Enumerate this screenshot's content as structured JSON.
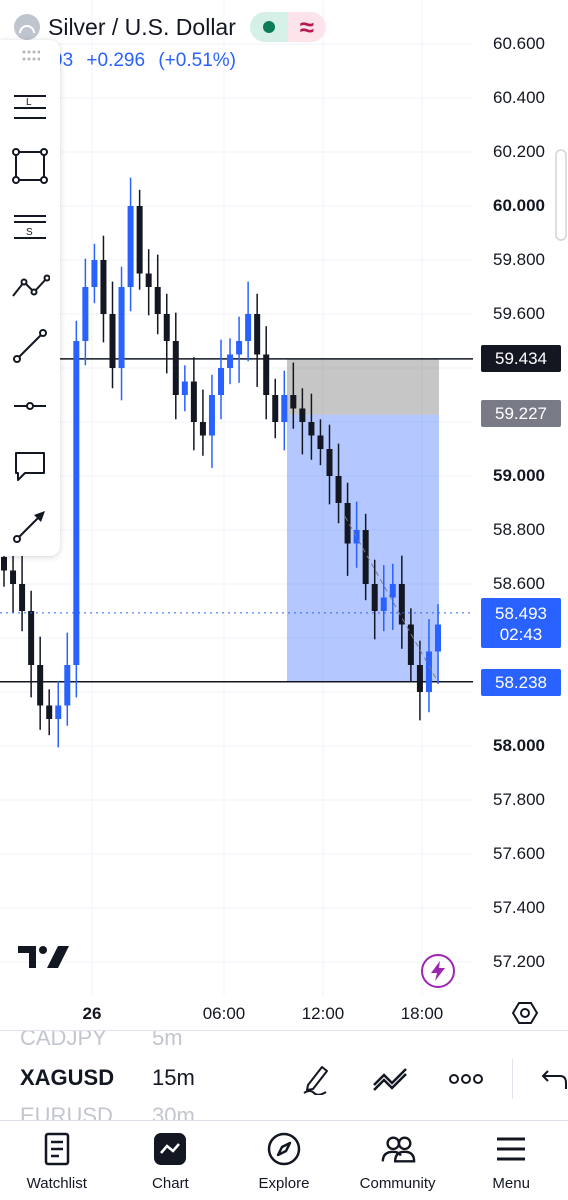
{
  "header": {
    "symbol_name": "Silver / U.S. Dollar",
    "last_price_partial": "93",
    "change": "+0.296",
    "change_pct": "(+0.51%)",
    "market_status_icon": "market-open-dot",
    "delay_icon": "approximate-icon"
  },
  "drawing_toolbar": {
    "tools": [
      "horizontal-lines-L-icon",
      "rectangle-icon",
      "horizontal-lines-S-icon",
      "polyline-icon",
      "trendline-icon",
      "horizontal-ray-icon",
      "callout-icon",
      "arrow-line-icon"
    ]
  },
  "price_axis": {
    "labels": [
      {
        "text": "60.600",
        "bold": false
      },
      {
        "text": "60.400",
        "bold": false
      },
      {
        "text": "60.200",
        "bold": false
      },
      {
        "text": "60.000",
        "bold": true
      },
      {
        "text": "59.800",
        "bold": false
      },
      {
        "text": "59.600",
        "bold": false
      },
      {
        "text": "59.000",
        "bold": true
      },
      {
        "text": "58.800",
        "bold": false
      },
      {
        "text": "58.600",
        "bold": false
      },
      {
        "text": "58.000",
        "bold": true
      },
      {
        "text": "57.800",
        "bold": false
      },
      {
        "text": "57.600",
        "bold": false
      },
      {
        "text": "57.400",
        "bold": false
      },
      {
        "text": "57.200",
        "bold": false
      }
    ]
  },
  "price_tags": {
    "upper_line": "59.434",
    "entry": "59.227",
    "current_price": "58.493",
    "countdown": "02:43",
    "lower_line": "58.238"
  },
  "time_axis": {
    "labels": [
      {
        "text": "26",
        "bold": true
      },
      {
        "text": "06:00",
        "bold": false
      },
      {
        "text": "12:00",
        "bold": false
      },
      {
        "text": "18:00",
        "bold": false
      }
    ]
  },
  "symbol_strip": {
    "rows": [
      {
        "symbol": "CADJPY",
        "interval": "5m",
        "state": "faded"
      },
      {
        "symbol": "XAGUSD",
        "interval": "15m",
        "state": "current"
      },
      {
        "symbol": "EURUSD",
        "interval": "30m",
        "state": "faded"
      }
    ],
    "tools": [
      "pencil-icon",
      "multi-line-icon",
      "more-dots-icon",
      "undo-icon"
    ]
  },
  "bottom_nav": {
    "items": [
      {
        "label": "Watchlist",
        "icon": "watchlist-icon"
      },
      {
        "label": "Chart",
        "icon": "chart-icon"
      },
      {
        "label": "Explore",
        "icon": "compass-icon"
      },
      {
        "label": "Community",
        "icon": "community-icon"
      },
      {
        "label": "Menu",
        "icon": "menu-icon"
      }
    ]
  },
  "colors": {
    "up_candle": "#2962ff",
    "down_candle": "#131722",
    "long_zone": "#2962ff",
    "stop_zone": "#808080",
    "label_dark": "#131722",
    "label_gray": "#787b86",
    "label_blue": "#2962ff",
    "bolt_purple": "#9c27b0"
  },
  "chart_data": {
    "type": "candlestick",
    "symbol": "XAGUSD",
    "interval": "15m",
    "ylim": [
      57.1,
      60.7
    ],
    "y_ticks": [
      60.6,
      60.4,
      60.2,
      60.0,
      59.8,
      59.6,
      59.4,
      59.2,
      59.0,
      58.8,
      58.6,
      58.4,
      58.2,
      58.0,
      57.8,
      57.6,
      57.4,
      57.2
    ],
    "x_ticks": [
      "26",
      "06:00",
      "12:00",
      "18:00"
    ],
    "horizontal_lines": [
      59.434,
      58.238
    ],
    "current_price": 58.493,
    "position": {
      "type": "long",
      "entry": 59.227,
      "stop": 59.434,
      "target": 58.238
    },
    "close_path": [
      58.65,
      58.6,
      58.5,
      58.3,
      58.15,
      58.1,
      58.15,
      58.3,
      59.5,
      59.7,
      59.8,
      59.6,
      59.4,
      59.7,
      60.0,
      59.75,
      59.7,
      59.6,
      59.5,
      59.3,
      59.35,
      59.2,
      59.15,
      59.3,
      59.4,
      59.45,
      59.5,
      59.6,
      59.45,
      59.3,
      59.2,
      59.3,
      59.25,
      59.2,
      59.15,
      59.1,
      59.0,
      58.9,
      58.75,
      58.8,
      58.6,
      58.5,
      58.55,
      58.6,
      58.45,
      58.3,
      58.2,
      58.35,
      58.45
    ]
  }
}
